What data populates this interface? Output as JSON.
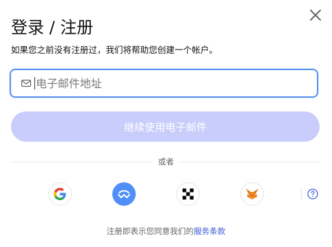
{
  "header": {
    "title": "登录 / 注册",
    "subtitle": "如果您之前没有注册过，我们将帮助您创建一个帐户。",
    "close_icon": "close-icon"
  },
  "email": {
    "placeholder": "电子邮件地址",
    "value": "",
    "icon": "mail-icon",
    "focus_color": "#5b95f0"
  },
  "continue_button": {
    "label": "继续使用电子邮件",
    "background": "#c8cdfb"
  },
  "divider": {
    "label": "或者"
  },
  "social": [
    {
      "name": "google",
      "icon": "google-icon"
    },
    {
      "name": "walletconnect",
      "icon": "walletconnect-icon",
      "background": "#4f8ff7"
    },
    {
      "name": "okx",
      "icon": "okx-icon"
    },
    {
      "name": "metamask",
      "icon": "metamask-fox-icon"
    }
  ],
  "help_icon": "question-circle-icon",
  "footer": {
    "prefix": "注册即表示您同意我们的",
    "link": "服务条款",
    "link_color": "#3b5bd9"
  }
}
